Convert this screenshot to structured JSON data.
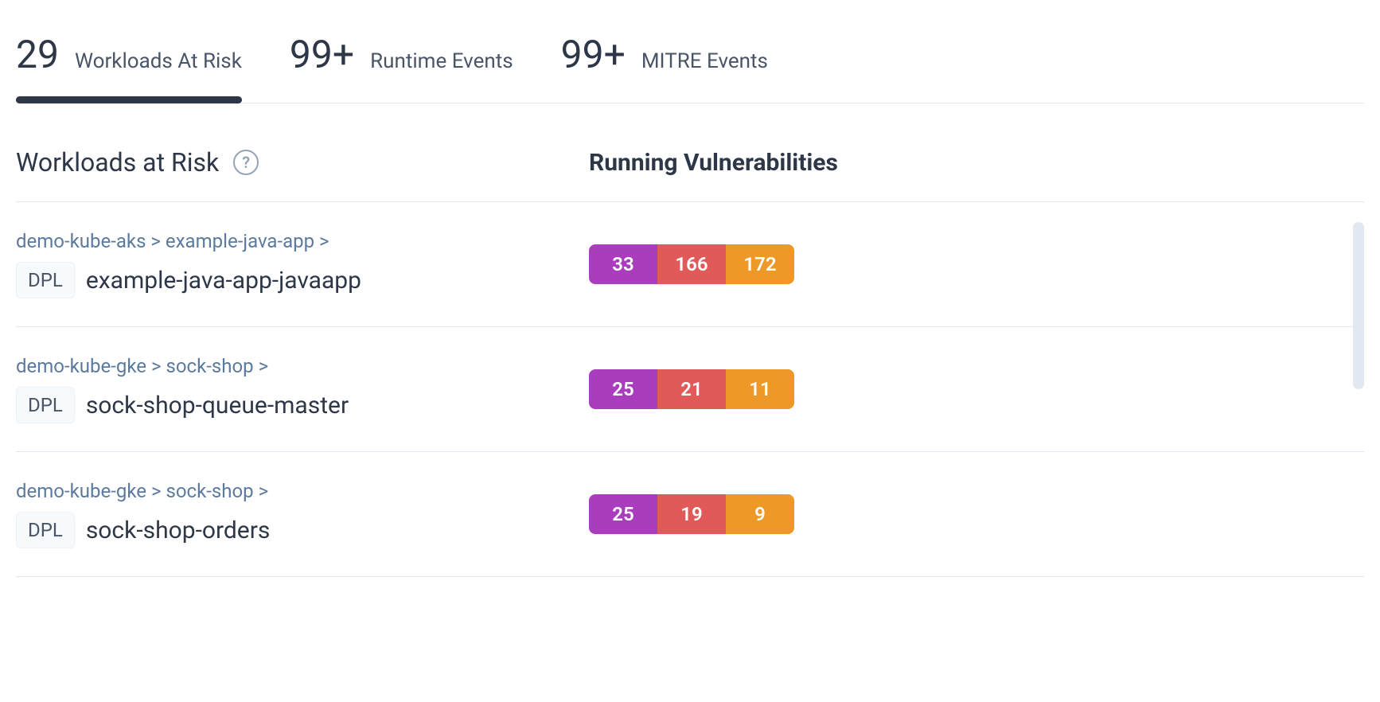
{
  "tabs": [
    {
      "value": "29",
      "label": "Workloads At Risk",
      "active": true
    },
    {
      "value": "99+",
      "label": "Runtime Events",
      "active": false
    },
    {
      "value": "99+",
      "label": "MITRE Events",
      "active": false
    }
  ],
  "section": {
    "title": "Workloads at Risk",
    "help": "?",
    "vuln_header": "Running Vulnerabilities"
  },
  "colors": {
    "critical": "#a93dbd",
    "high": "#e05a5a",
    "medium": "#ee9827"
  },
  "rows": [
    {
      "breadcrumb": "demo-kube-aks > example-java-app >",
      "badge": "DPL",
      "name": "example-java-app-javaapp",
      "vulns": {
        "critical": "33",
        "high": "166",
        "medium": "172"
      }
    },
    {
      "breadcrumb": "demo-kube-gke > sock-shop >",
      "badge": "DPL",
      "name": "sock-shop-queue-master",
      "vulns": {
        "critical": "25",
        "high": "21",
        "medium": "11"
      }
    },
    {
      "breadcrumb": "demo-kube-gke > sock-shop >",
      "badge": "DPL",
      "name": "sock-shop-orders",
      "vulns": {
        "critical": "25",
        "high": "19",
        "medium": "9"
      }
    }
  ]
}
